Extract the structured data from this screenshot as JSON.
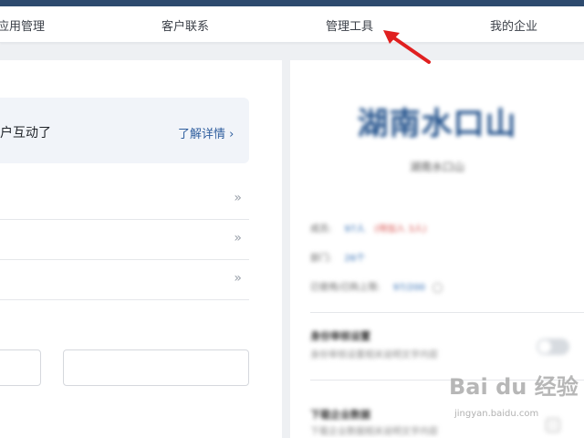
{
  "nav": {
    "items": [
      {
        "label": "应用管理"
      },
      {
        "label": "客户联系"
      },
      {
        "label": "管理工具"
      },
      {
        "label": "我的企业"
      }
    ]
  },
  "main": {
    "banner_text": "户互动了",
    "banner_link": "了解详情 ›",
    "list_rows": [
      {
        "chevron": "»"
      },
      {
        "chevron": "»"
      },
      {
        "chevron": "»"
      }
    ]
  },
  "company_panel": {
    "name": "湖南水口山",
    "subtitle": "湖南水口山",
    "info": [
      {
        "label": "成员:",
        "value": "97人",
        "extra": "(待加入 3人)"
      },
      {
        "label": "部门:",
        "value": "26个",
        "extra": ""
      },
      {
        "label": "已使用/已购上限:",
        "value": "97/200",
        "extra": ""
      }
    ],
    "settings": [
      {
        "title": "身份审核设置",
        "desc": "身份审核设置相关说明文字内容"
      },
      {
        "title": "下载企业数据",
        "desc": "下载企业数据相关说明文字内容"
      }
    ]
  },
  "watermark": {
    "main": "Bai du 经验",
    "url": "jingyan.baidu.com"
  },
  "colors": {
    "topbar": "#2d4a6e",
    "link": "#2f5e9e",
    "company_name": "#1f4f8a",
    "annotation_arrow": "#e02020"
  },
  "annotation": {
    "icon": "red-arrow-icon"
  }
}
